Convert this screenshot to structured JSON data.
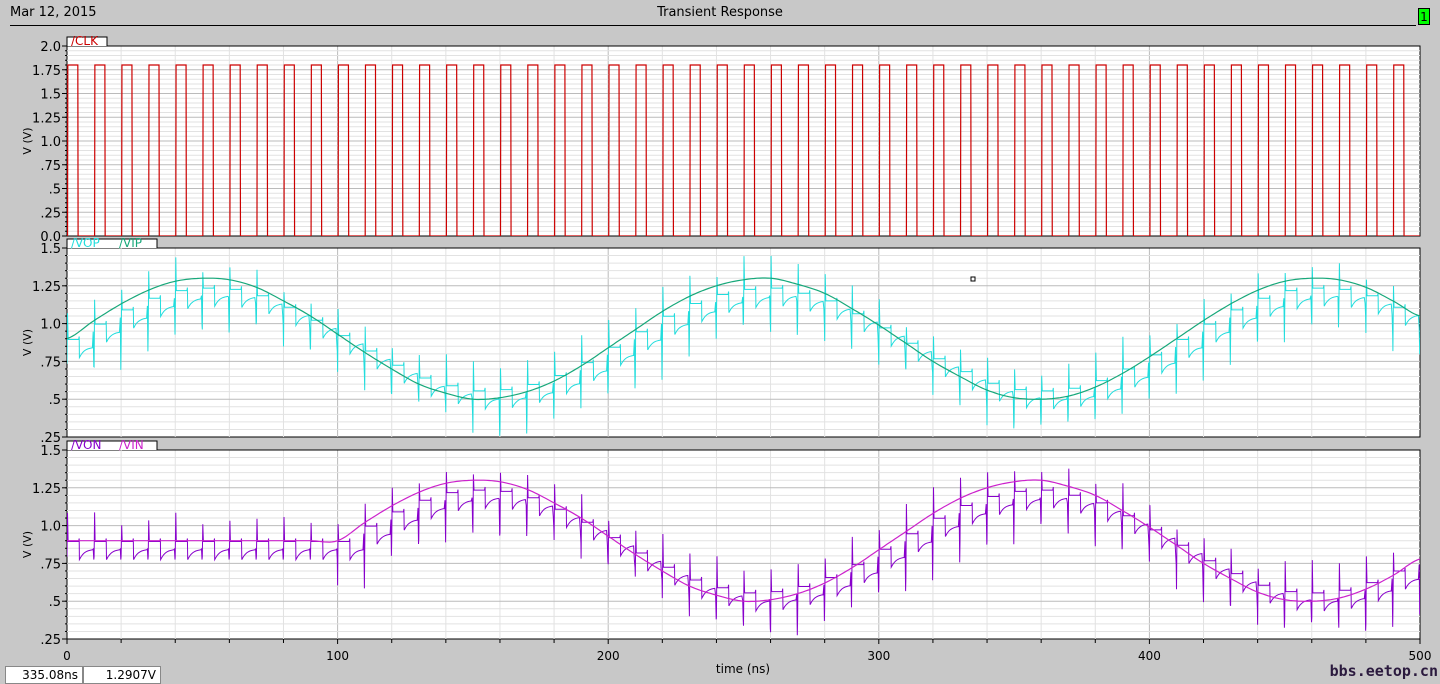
{
  "header": {
    "date": "Mar 12, 2015",
    "title": "Transient Response",
    "window_badge": "1"
  },
  "status": {
    "cursor_x": "335.08ns",
    "cursor_y": "1.2907V"
  },
  "watermark": "bbs.eetop.cn",
  "chart_data": [
    {
      "type": "line",
      "ylabel": "V (V)",
      "ylim": [
        0,
        2.0
      ],
      "yticks": [
        "0.0",
        ".25",
        ".5",
        ".75",
        "1.0",
        "1.25",
        "1.5",
        "1.75",
        "2.0"
      ],
      "series": [
        {
          "name": "/CLK",
          "color": "#cc0000",
          "period_ns": 10,
          "high_ns": 4,
          "high": 1.8,
          "low": 0
        }
      ]
    },
    {
      "type": "line",
      "ylabel": "V (V)",
      "ylim": [
        0.25,
        1.5
      ],
      "yticks": [
        ".25",
        ".5",
        ".75",
        "1.0",
        "1.25",
        "1.5"
      ],
      "series": [
        {
          "name": "/VOP",
          "color": "#22dddd",
          "x_step_ns": 10,
          "y": [
            0.9,
            1.02,
            1.13,
            1.22,
            1.28,
            1.3,
            1.29,
            1.24,
            1.15,
            1.05,
            0.93,
            0.81,
            0.7,
            0.6,
            0.54,
            0.5,
            0.51,
            0.55,
            0.62,
            0.72,
            0.84,
            0.96,
            1.08,
            1.18,
            1.25,
            1.29,
            1.3,
            1.26,
            1.2,
            1.1,
            0.99,
            0.87,
            0.75,
            0.65,
            0.56,
            0.51,
            0.5,
            0.52,
            0.58,
            0.67,
            0.78,
            0.9,
            1.02,
            1.13,
            1.22,
            1.28,
            1.3,
            1.29,
            1.24,
            1.15,
            1.05
          ]
        },
        {
          "name": "/VIP",
          "color": "#17a87a",
          "x_step_ns": 10,
          "y": [
            0.9,
            1.02,
            1.13,
            1.22,
            1.28,
            1.3,
            1.29,
            1.24,
            1.15,
            1.05,
            0.93,
            0.81,
            0.7,
            0.6,
            0.54,
            0.5,
            0.51,
            0.55,
            0.62,
            0.72,
            0.84,
            0.96,
            1.08,
            1.18,
            1.25,
            1.29,
            1.3,
            1.26,
            1.2,
            1.1,
            0.99,
            0.87,
            0.75,
            0.65,
            0.56,
            0.51,
            0.5,
            0.52,
            0.58,
            0.67,
            0.78,
            0.9,
            1.02,
            1.13,
            1.22,
            1.28,
            1.3,
            1.29,
            1.24,
            1.15,
            1.05
          ]
        }
      ]
    },
    {
      "type": "line",
      "ylabel": "V (V)",
      "ylim": [
        0.25,
        1.5
      ],
      "yticks": [
        ".25",
        ".5",
        ".75",
        "1.0",
        "1.25",
        "1.5"
      ],
      "series": [
        {
          "name": "/VON",
          "color": "#8800cc",
          "x_step_ns": 10,
          "y": [
            0.9,
            0.9,
            0.9,
            0.9,
            0.9,
            0.9,
            0.9,
            0.9,
            0.9,
            0.9,
            0.9,
            1.02,
            1.13,
            1.22,
            1.28,
            1.3,
            1.29,
            1.24,
            1.15,
            1.05,
            0.93,
            0.81,
            0.7,
            0.6,
            0.54,
            0.5,
            0.51,
            0.55,
            0.62,
            0.72,
            0.84,
            0.96,
            1.08,
            1.18,
            1.25,
            1.29,
            1.3,
            1.26,
            1.2,
            1.1,
            0.99,
            0.87,
            0.75,
            0.65,
            0.56,
            0.51,
            0.5,
            0.52,
            0.58,
            0.67,
            0.78
          ]
        },
        {
          "name": "/VIN",
          "color": "#cc22cc",
          "x_step_ns": 10,
          "y": [
            0.9,
            0.9,
            0.9,
            0.9,
            0.9,
            0.9,
            0.9,
            0.9,
            0.9,
            0.9,
            0.9,
            1.02,
            1.13,
            1.22,
            1.28,
            1.3,
            1.29,
            1.24,
            1.15,
            1.05,
            0.93,
            0.81,
            0.7,
            0.6,
            0.54,
            0.5,
            0.51,
            0.55,
            0.62,
            0.72,
            0.84,
            0.96,
            1.08,
            1.18,
            1.25,
            1.29,
            1.3,
            1.26,
            1.2,
            1.1,
            0.99,
            0.87,
            0.75,
            0.65,
            0.56,
            0.51,
            0.5,
            0.52,
            0.58,
            0.67,
            0.78
          ]
        }
      ]
    }
  ],
  "xaxis": {
    "label": "time (ns)",
    "xlim": [
      0,
      500
    ],
    "ticks": [
      "0",
      "100",
      "200",
      "300",
      "400",
      "500"
    ]
  }
}
